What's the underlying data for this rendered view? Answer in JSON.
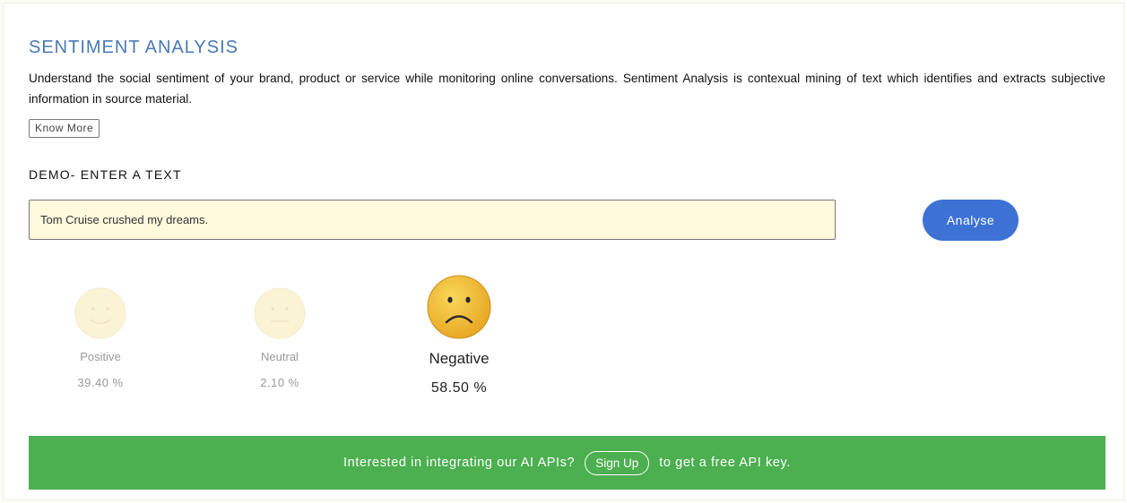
{
  "header": {
    "title": "SENTIMENT ANALYSIS",
    "description": "Understand the social sentiment of your brand, product or service while monitoring online conversations. Sentiment Analysis is contexual mining of text which identifies and extracts subjective information in source material.",
    "know_more_label": "Know More"
  },
  "demo": {
    "label": "DEMO- ENTER A TEXT",
    "input_value": "Tom Cruise crushed my dreams.",
    "analyse_label": "Analyse"
  },
  "results": [
    {
      "label": "Positive",
      "percent": "39.40 %",
      "icon": "smile-face-icon",
      "active": false
    },
    {
      "label": "Neutral",
      "percent": "2.10 %",
      "icon": "neutral-face-icon",
      "active": false
    },
    {
      "label": "Negative",
      "percent": "58.50 %",
      "icon": "sad-face-icon",
      "active": true
    }
  ],
  "banner": {
    "text_before": "Interested in integrating our AI APIs?",
    "signup_label": "Sign Up",
    "text_after": "to get a free API key."
  },
  "colors": {
    "title": "#4a79b5",
    "analyse_button": "#3d72d4",
    "input_background": "#fff9dd",
    "banner": "#4caf50",
    "face_active": "#f2b92c",
    "face_faded": "#fbf4d4"
  }
}
